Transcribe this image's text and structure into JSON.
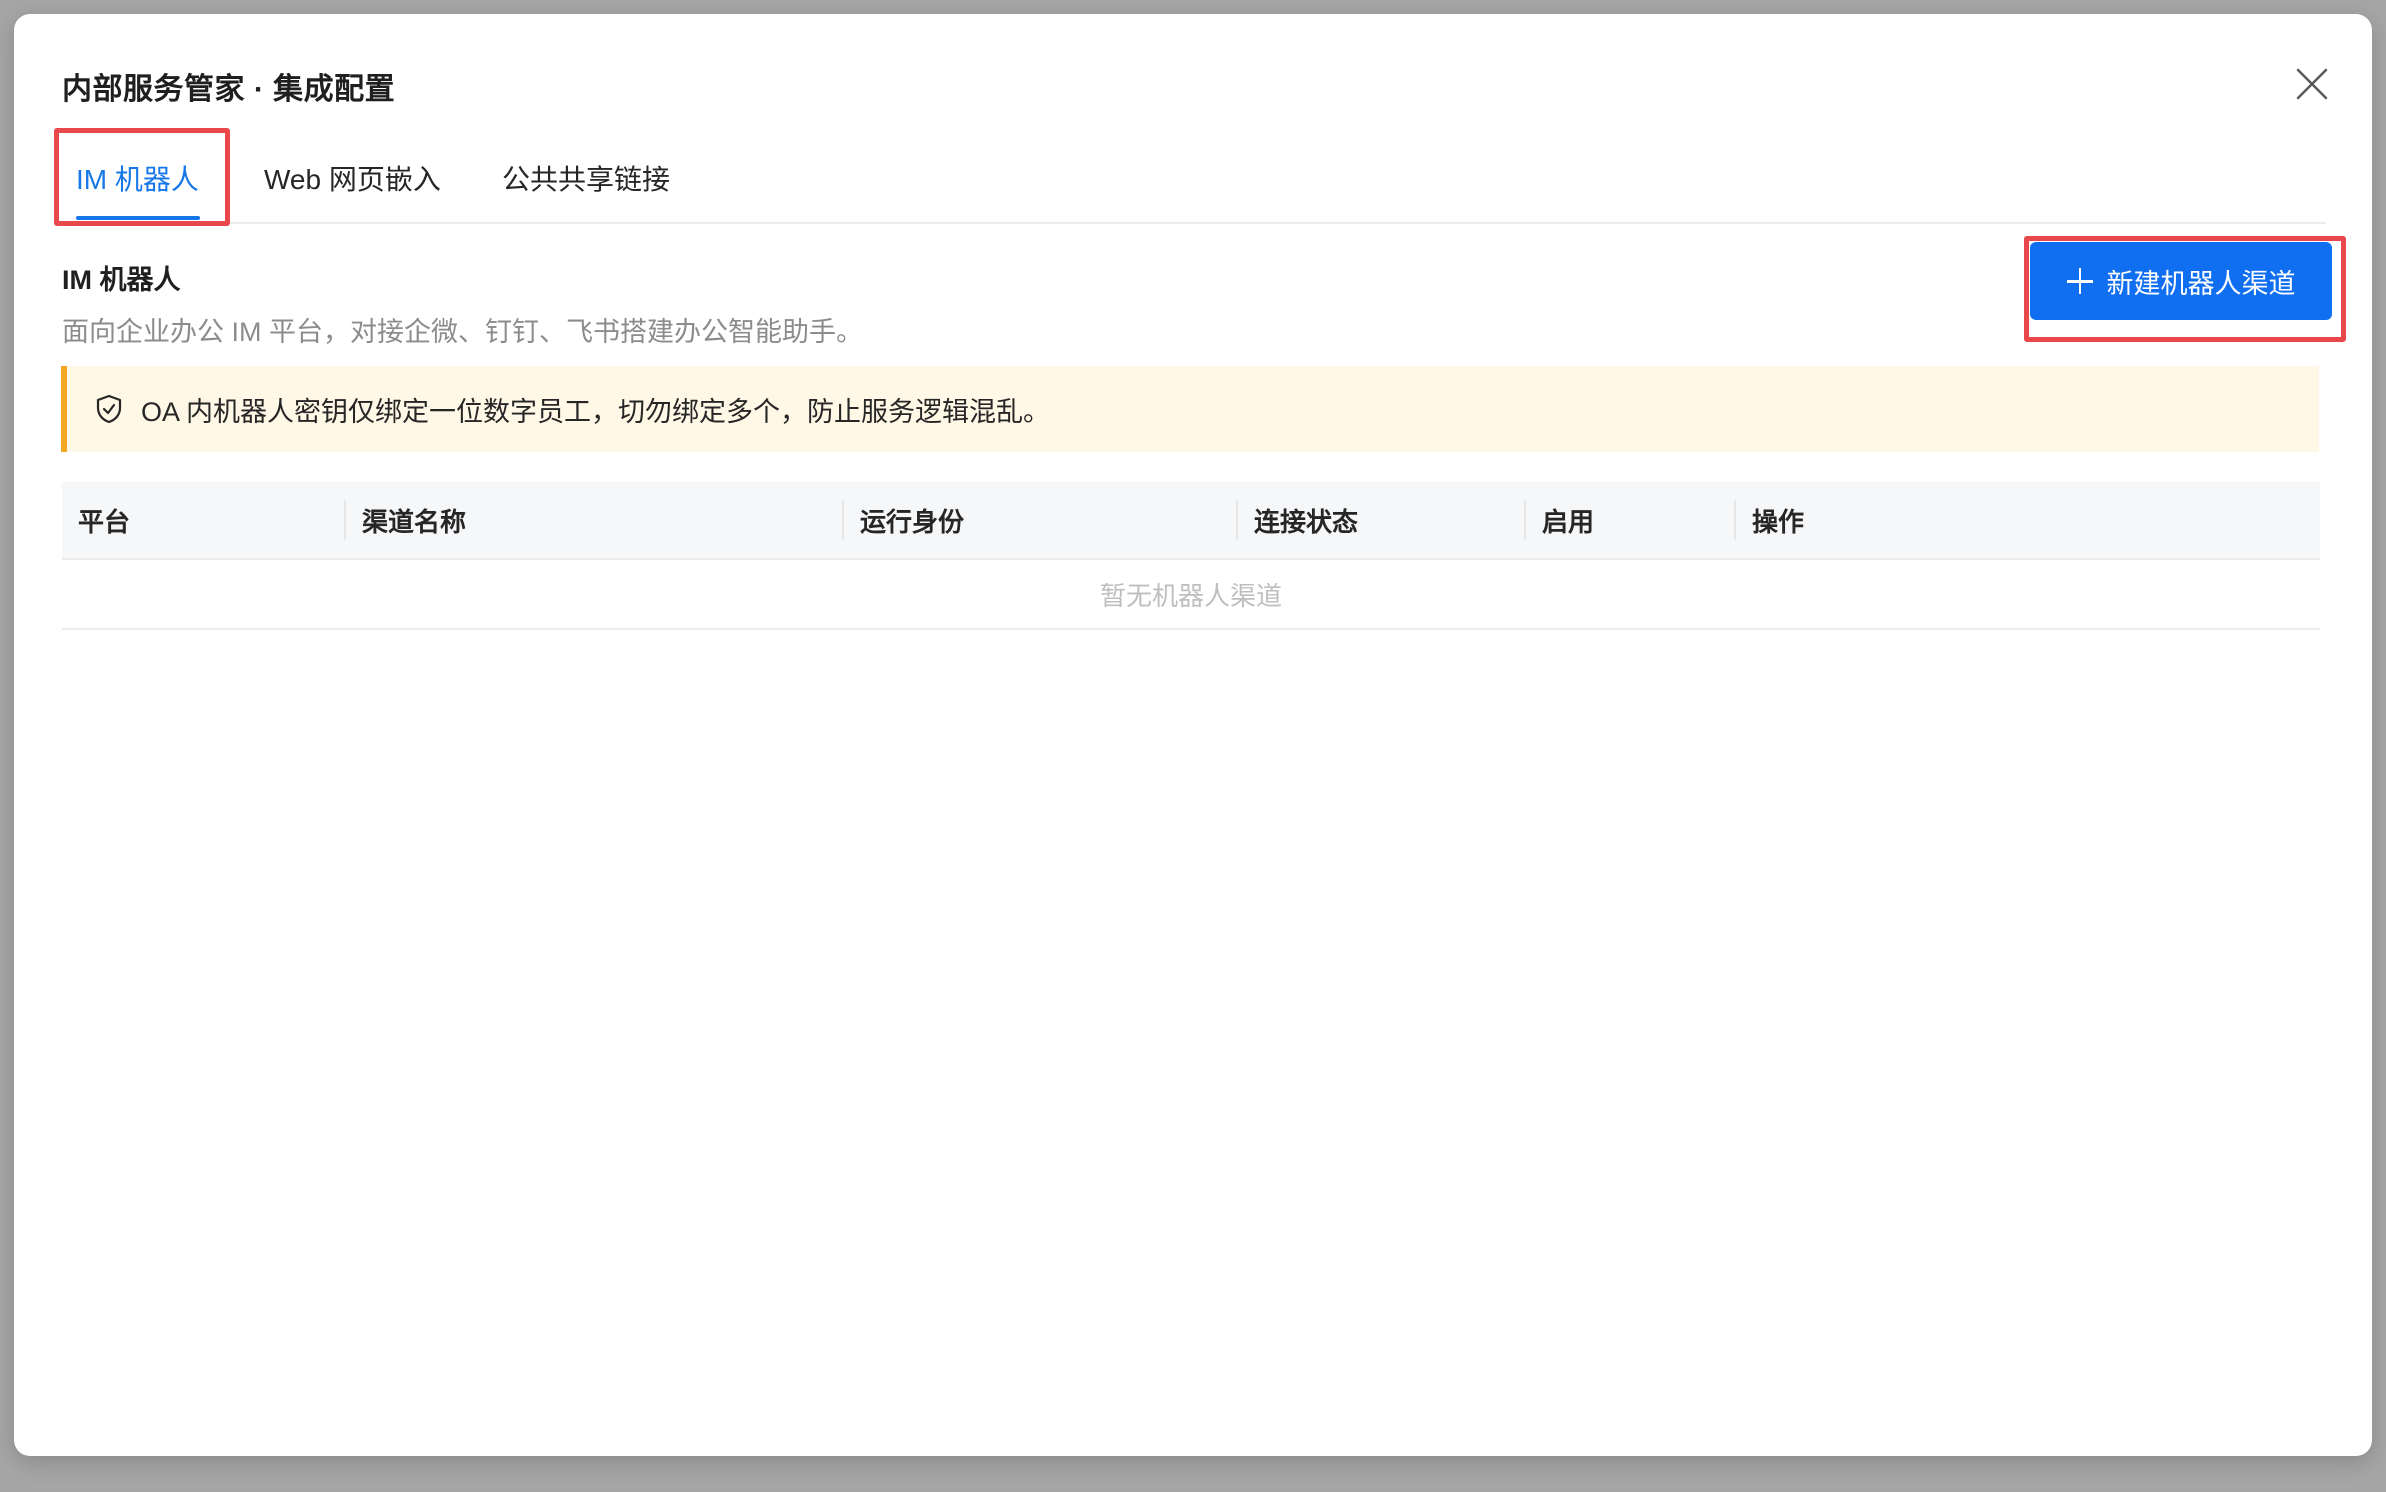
{
  "modal": {
    "title": "内部服务管家 · 集成配置"
  },
  "tabs": [
    {
      "label": "IM 机器人",
      "active": true
    },
    {
      "label": "Web 网页嵌入",
      "active": false
    },
    {
      "label": "公共共享链接",
      "active": false
    }
  ],
  "section": {
    "title": "IM 机器人",
    "description": "面向企业办公 IM 平台，对接企微、钉钉、飞书搭建办公智能助手。"
  },
  "new_channel_button": {
    "label": "新建机器人渠道",
    "icon": "plus-icon"
  },
  "alert": {
    "icon": "shield-check-icon",
    "text": "OA 内机器人密钥仅绑定一位数字员工，切勿绑定多个，防止服务逻辑混乱。"
  },
  "table": {
    "columns": [
      "平台",
      "渠道名称",
      "运行身份",
      "连接状态",
      "启用",
      "操作"
    ],
    "rows": [],
    "empty_text": "暂无机器人渠道"
  },
  "colors": {
    "accent": "#1677e8",
    "primary_button": "#0f6ff0",
    "alert_background": "#fff8e6",
    "alert_border": "#f3a824",
    "highlight": "#e8474c"
  }
}
